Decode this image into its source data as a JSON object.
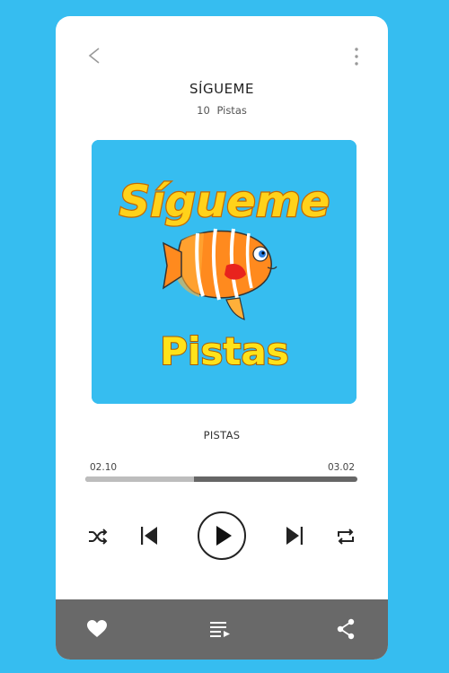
{
  "header": {
    "back_icon": "chevron-left-icon",
    "menu_icon": "more-vertical-icon"
  },
  "album": {
    "title": "SÍGUEME",
    "track_count": "10",
    "track_count_label": "Pistas",
    "cover": {
      "title_text": "Sígueme",
      "subtitle_text": "Pistas",
      "background_color": "#36bdf0"
    }
  },
  "now_playing": {
    "track_name": "PISTAS",
    "elapsed": "02.10",
    "duration": "03.02",
    "progress_fraction": 0.4
  },
  "controls": {
    "shuffle_icon": "shuffle-icon",
    "previous_icon": "skip-previous-icon",
    "play_icon": "play-icon",
    "next_icon": "skip-next-icon",
    "repeat_icon": "repeat-icon"
  },
  "bottom_bar": {
    "favorite_icon": "heart-icon",
    "queue_icon": "playlist-icon",
    "share_icon": "share-icon",
    "background_color": "#696969"
  },
  "colors": {
    "page_background": "#36bdf0",
    "card_background": "#ffffff",
    "progress_track": "#666666",
    "progress_fill": "#bdbdbd"
  }
}
